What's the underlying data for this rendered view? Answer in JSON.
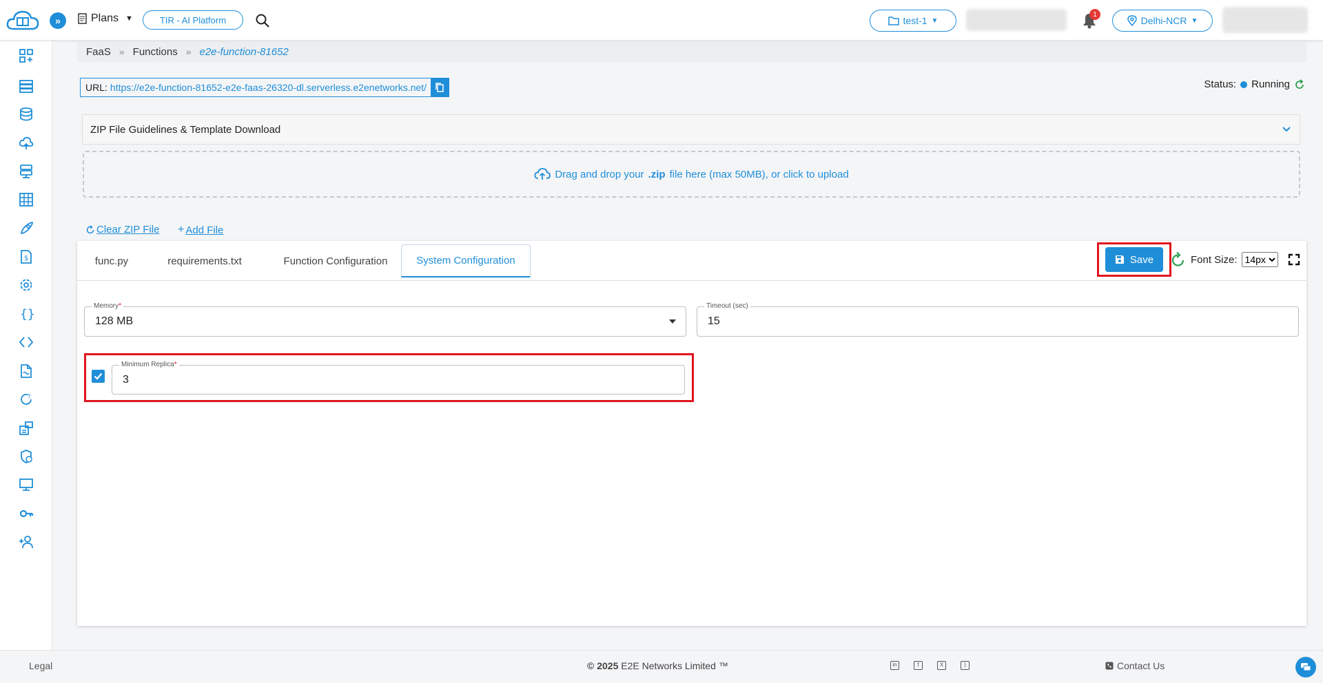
{
  "topbar": {
    "plans_label": "Plans",
    "tir_label": "TIR - AI Platform",
    "project_label": "test-1",
    "notification_count": "1",
    "region_label": "Delhi-NCR"
  },
  "sidebar": {
    "icons": [
      "dashboard-icon",
      "nodes-icon",
      "database-icon",
      "cloud-upload-icon",
      "storage-icon",
      "grid-icon",
      "rocket-icon",
      "billing-icon",
      "settings-icon",
      "braces-icon",
      "code-icon",
      "document-icon",
      "refresh-question-icon",
      "network-icon",
      "security-icon",
      "monitor-icon",
      "key-icon",
      "add-user-icon"
    ]
  },
  "breadcrumb": {
    "items": [
      "FaaS",
      "Functions"
    ],
    "separator": "»",
    "current": "e2e-function-81652"
  },
  "url": {
    "label": "URL:",
    "value": "https://e2e-function-81652-e2e-faas-26320-dl.serverless.e2enetworks.net/"
  },
  "status": {
    "label": "Status:",
    "value": "Running"
  },
  "accordion": {
    "title": "ZIP File Guidelines & Template Download"
  },
  "dropzone": {
    "prefix": "Drag and drop your",
    "ext": ".zip",
    "suffix": "file here (max 50MB), or click to upload"
  },
  "actions": {
    "clear_zip": "Clear ZIP File",
    "add_file": "Add File"
  },
  "editor": {
    "tabs": [
      "func.py",
      "requirements.txt",
      "Function Configuration",
      "System Configuration"
    ],
    "active_tab": "System Configuration",
    "save_label": "Save",
    "font_size_label": "Font Size:",
    "font_size_value": "14px",
    "font_size_options": [
      "14px"
    ]
  },
  "system_config": {
    "memory_label": "Memory",
    "memory_value": "128 MB",
    "timeout_label": "Timeout (sec)",
    "timeout_value": "15",
    "min_replica_label": "Minimum Replica",
    "min_replica_value": "3",
    "min_replica_checked": true,
    "required_mark": "*"
  },
  "footer": {
    "legal": "Legal",
    "copyright_prefix": "© 2025",
    "copyright_text": "E2E Networks Limited ™",
    "contact": "Contact Us",
    "social_icons": [
      "linkedin-icon",
      "facebook-icon",
      "x-icon",
      "rss-icon"
    ]
  },
  "colors": {
    "accent": "#1f8ed8",
    "highlight": "#e0141e",
    "running": "#2e9e4f"
  }
}
